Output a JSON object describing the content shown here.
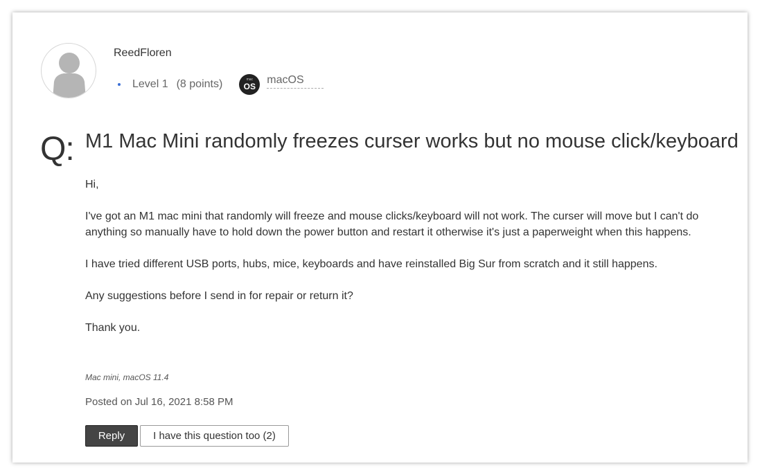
{
  "author": {
    "name": "ReedFloren",
    "level": "Level 1",
    "points": "(8 points)",
    "os_badge_small": "mac",
    "os_badge_big": "OS",
    "os_label": "macOS",
    "avatar_icon": "default-user-silhouette"
  },
  "question": {
    "q_mark": "Q:",
    "title": "M1 Mac Mini randomly freezes curser works but no mouse click/keyboard",
    "paragraphs": [
      "Hi,",
      "I've got an M1 mac mini that randomly will freeze and mouse clicks/keyboard will not work. The curser will move but I can't do anything so manually have to hold down the power button and restart it otherwise it's just a paperweight when this happens.",
      "I have tried different USB ports, hubs, mice, keyboards and have reinstalled Big Sur from scratch and it still happens.",
      "Any suggestions before I send in for repair or return it?",
      "Thank you."
    ],
    "product_tag": "Mac mini, macOS 11.4",
    "posted": "Posted on Jul 16, 2021 8:58 PM"
  },
  "actions": {
    "reply_label": "Reply",
    "me_too_label": "I have this question too (2)"
  },
  "colors": {
    "level_dot": "#3b6fd6",
    "reply_button_bg": "#444444",
    "os_badge_bg": "#222222"
  }
}
